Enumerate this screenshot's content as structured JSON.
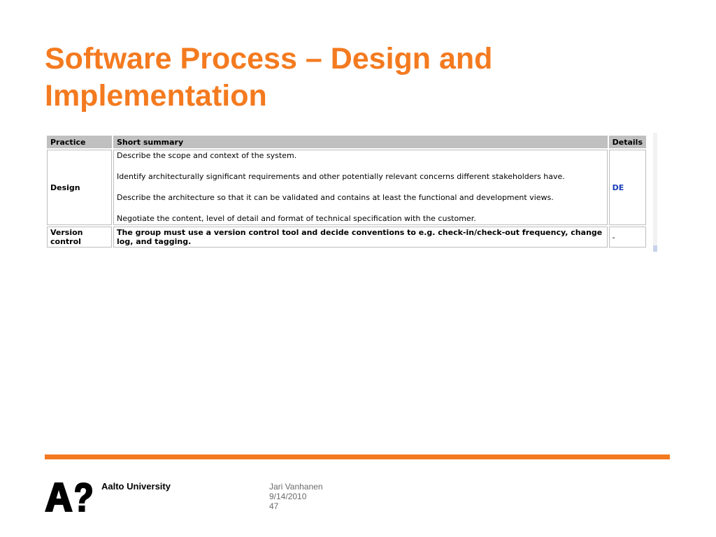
{
  "slide": {
    "title": "Software Process – Design and Implementation"
  },
  "table": {
    "headers": {
      "practice": "Practice",
      "summary": "Short summary",
      "details": "Details"
    },
    "rows": [
      {
        "practice": "Design",
        "summary": [
          "Describe the scope and context of the system.",
          "Identify architecturally significant requirements and other potentially relevant concerns different stakeholders have.",
          "Describe the architecture so that it can be validated and contains at least the functional and development views.",
          "Negotiate the content, level of detail and format of technical specification with the customer."
        ],
        "details": "DE"
      },
      {
        "practice": "Version control",
        "summary": [
          "The group must use a version control tool and decide conventions to e.g. check-in/check-out frequency, change log, and tagging."
        ],
        "details": "-"
      }
    ]
  },
  "footer": {
    "logo_text": "A?",
    "university": "Aalto University",
    "author": "Jari Vanhanen",
    "date": "9/14/2010",
    "page": "47"
  },
  "colors": {
    "accent": "#f47a1f",
    "header_bg": "#c0c0c0",
    "link": "#1a3cb8"
  }
}
